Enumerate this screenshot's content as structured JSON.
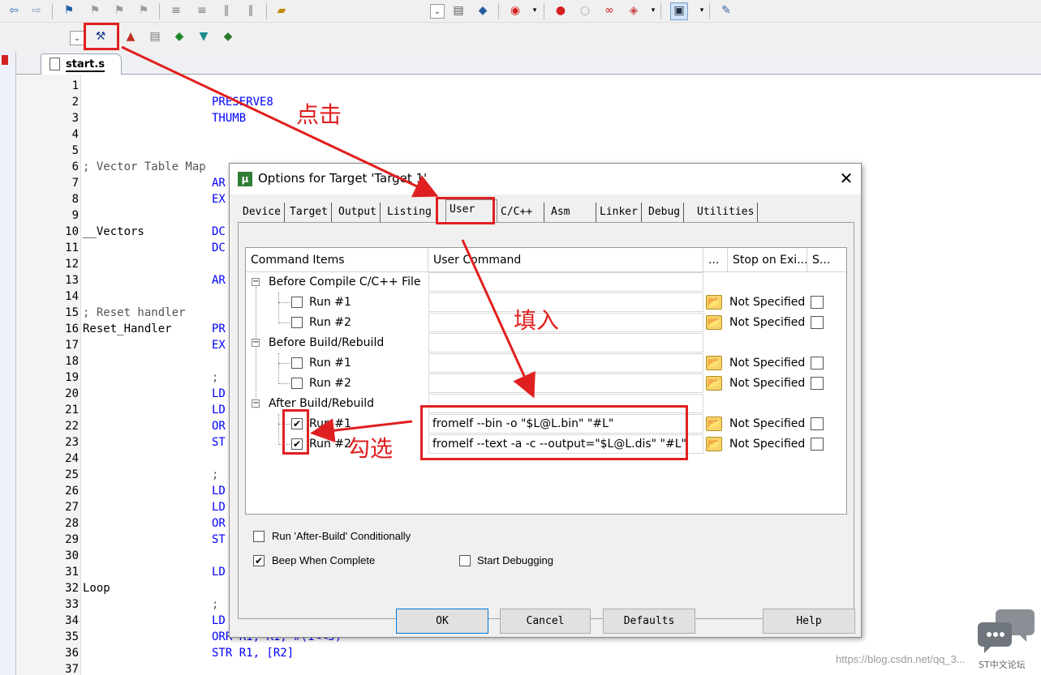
{
  "toolbar1": {
    "icons": [
      "back-arrow-icon",
      "forward-arrow-icon",
      "bookmark-icon",
      "prev-bookmark-icon",
      "next-bookmark-icon",
      "clear-bookmarks-icon",
      "indent-icon",
      "unindent-icon",
      "comment-icon",
      "uncomment-icon",
      "open-file-icon",
      "dropdown-icon",
      "find-in-files-icon",
      "config-icon",
      "debug-session-icon",
      "breakpoint-icon",
      "disable-breakpoint-icon",
      "kill-breakpoints-icon",
      "trace-icon",
      "window-icon",
      "tools-icon"
    ]
  },
  "toolbar2": {
    "icons": [
      "target-options-icon",
      "manage-components-icon",
      "copy-icon",
      "pack-installer-icon",
      "select-device-icon",
      "build-icon"
    ]
  },
  "editor_tab": {
    "label": "start.s"
  },
  "editor": {
    "line_numbers": [
      "1",
      "2",
      "3",
      "4",
      "5",
      "6",
      "7",
      "8",
      "9",
      "10",
      "11",
      "12",
      "13",
      "14",
      "15",
      "16",
      "17",
      "18",
      "19",
      "20",
      "21",
      "22",
      "23",
      "24",
      "25",
      "26",
      "27",
      "28",
      "29",
      "30",
      "31",
      "32",
      "33",
      "34",
      "35",
      "36",
      "37"
    ],
    "lines": {
      "l2": "PRESERVE8",
      "l3": "THUMB",
      "l6": "; Vector Table Map",
      "l7": "AR",
      "l8": "EX",
      "l10a": "__Vectors",
      "l10b": "DC",
      "l11": "DC",
      "l13": "AR",
      "l15": "; Reset handler",
      "l16a": "Reset_Handler",
      "l16b": "PR",
      "l17": "EX",
      "l19": ";",
      "l20": "LD",
      "l21": "LD",
      "l22": "OR",
      "l23": "ST",
      "l25": ";",
      "l26": "LD",
      "l27": "LD",
      "l28": "OR",
      "l29": "ST",
      "l31": "LD",
      "l32": "Loop",
      "l33": ";",
      "l34": "LD",
      "l35": "ORR R1, R1, #(1<<5)",
      "l36": "STR R1, [R2]"
    }
  },
  "dialog": {
    "title": "Options for Target 'Target 1'",
    "tabs": [
      "Device",
      "Target",
      "Output",
      "Listing",
      "User",
      "C/C++",
      "Asm",
      "Linker",
      "Debug",
      "Utilities"
    ],
    "active_tab": "User",
    "grid": {
      "headers": [
        "Command Items",
        "User Command",
        "...",
        "Stop on Exi...",
        "S..."
      ],
      "groups": [
        {
          "label": "Before Compile C/C++ File",
          "runs": [
            {
              "label": "Run #1",
              "checked": false,
              "command": "",
              "stop": "Not Specified"
            },
            {
              "label": "Run #2",
              "checked": false,
              "command": "",
              "stop": "Not Specified"
            }
          ]
        },
        {
          "label": "Before Build/Rebuild",
          "runs": [
            {
              "label": "Run #1",
              "checked": false,
              "command": "",
              "stop": "Not Specified"
            },
            {
              "label": "Run #2",
              "checked": false,
              "command": "",
              "stop": "Not Specified"
            }
          ]
        },
        {
          "label": "After Build/Rebuild",
          "runs": [
            {
              "label": "Run #1",
              "checked": true,
              "command": "fromelf --bin -o \"$L@L.bin\" \"#L\"",
              "stop": "Not Specified"
            },
            {
              "label": "Run #2",
              "checked": true,
              "command": "fromelf --text -a -c --output=\"$L@L.dis\" \"#L\"",
              "stop": "Not Specified"
            }
          ]
        }
      ]
    },
    "options": {
      "run_after_build": {
        "label": "Run 'After-Build' Conditionally",
        "checked": false
      },
      "beep": {
        "label": "Beep When Complete",
        "checked": true
      },
      "start_debug": {
        "label": "Start Debugging",
        "checked": false
      }
    },
    "buttons": {
      "ok": "OK",
      "cancel": "Cancel",
      "defaults": "Defaults",
      "help": "Help"
    }
  },
  "annotations": {
    "click": "点击",
    "fill": "填入",
    "check": "勾选",
    "color": "#e02020"
  },
  "watermark": {
    "url": "https://blog.csdn.net/qq_3...",
    "brand": "ST中文论坛"
  }
}
